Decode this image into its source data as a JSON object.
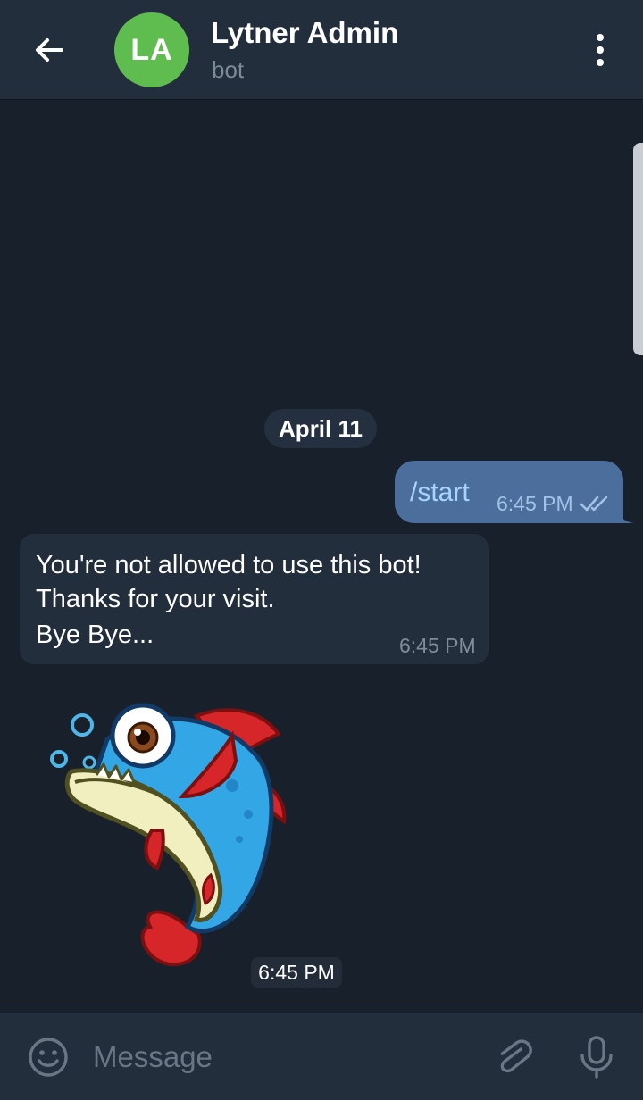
{
  "header": {
    "avatar_initials": "LA",
    "avatar_color": "#5fbd4f",
    "title": "Lytner Admin",
    "subtitle": "bot",
    "back_icon": "arrow-left-icon",
    "menu_icon": "more-vertical-icon"
  },
  "chat": {
    "date_separator": "April 11",
    "messages": [
      {
        "direction": "outgoing",
        "text": "/start",
        "time": "6:45 PM",
        "status_icon": "double-check-icon"
      },
      {
        "direction": "incoming",
        "lines": [
          "You're not allowed to use this bot!",
          "Thanks for your visit.",
          "Bye Bye..."
        ],
        "time": "6:45 PM"
      },
      {
        "direction": "incoming",
        "type": "sticker",
        "sticker": "piranha-fish-sticker",
        "time": "6:45 PM"
      }
    ]
  },
  "composer": {
    "placeholder": "Message",
    "emoji_icon": "emoji-smile-icon",
    "attach_icon": "paperclip-icon",
    "mic_icon": "microphone-icon"
  },
  "colors": {
    "background": "#18202b",
    "header": "#232e3c",
    "outgoing_bubble": "#4b6e9c",
    "incoming_bubble": "#232e3c",
    "link": "#a6d6ff"
  }
}
